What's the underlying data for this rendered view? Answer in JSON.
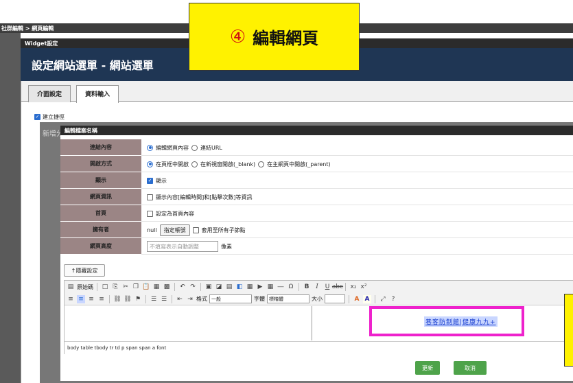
{
  "breadcrumb": "社群編輯 > 網頁編輯",
  "widget_title": "Widget設定",
  "header_title": "設定網站選單 - 網站選單",
  "tabs": [
    {
      "label": "介面設定"
    },
    {
      "label": "資料輸入"
    }
  ],
  "shortcut_label": "建立捷徑",
  "background_hint": "新增分",
  "dialog": {
    "title": "編輯檔案名稱",
    "rows": {
      "link_content": {
        "label": "連結內容",
        "opt1": "編輯網頁內容",
        "opt2": "連結URL"
      },
      "open_mode": {
        "label": "開啟方式",
        "opt1": "在頁框中開啟",
        "opt2": "在新視窗開啟(_blank)",
        "opt3": "在主網頁中開啟(_parent)"
      },
      "display": {
        "label": "顯示",
        "check": "顯示"
      },
      "page_info": {
        "label": "網頁資訊",
        "check": "顯示內容[編輯時間]和[點擊次數]等資訊"
      },
      "home": {
        "label": "首頁",
        "check": "設定為首頁內容"
      },
      "owner": {
        "label": "擁有者",
        "value": "null",
        "button": "指定帳號",
        "check": "套用至所有子節點"
      },
      "height": {
        "label": "網頁高度",
        "placeholder": "不填寫表示自動調整",
        "unit": "像素"
      }
    },
    "hide_button": "↑隱藏設定"
  },
  "editor": {
    "source_label": "原始碼",
    "format_label": "格式",
    "format_value": "一般",
    "font_label": "字體",
    "font_value": "標楷體",
    "size_label": "大小",
    "link_text": "巷客防制館|健康九九+",
    "path": "body  table  tbody  tr  td  p  span  span  a  font"
  },
  "buttons": {
    "update": "更新",
    "cancel": "取消"
  },
  "callout": {
    "number": "④",
    "text": "編輯網頁"
  },
  "colors": {
    "header_bg": "#1f3654",
    "label_bg": "#9b8585",
    "button_green": "#4ea34a",
    "callout_yellow": "#fff200",
    "highlight_pink": "#ee22cc"
  }
}
